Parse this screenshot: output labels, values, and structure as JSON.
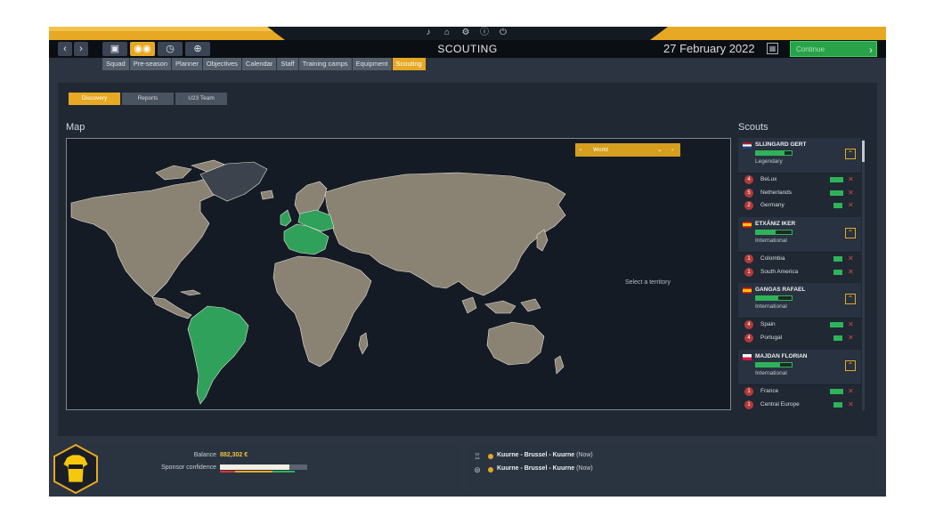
{
  "topbar": {
    "icons": [
      "bell-icon",
      "home-icon",
      "gear-icon",
      "info-icon",
      "power-icon"
    ],
    "colors": {
      "gold": "#e7a823",
      "bar": "#141a22"
    }
  },
  "navbar": {
    "back": "‹",
    "forward": "›",
    "title": "SCOUTING",
    "date": "27 February 2022",
    "continue_label": "Continue",
    "continue_arrow": "›"
  },
  "subtabs": [
    "Squad",
    "Pre-season",
    "Planner",
    "Objectives",
    "Calendar",
    "Staff",
    "Training camps",
    "Equipment",
    "Scouting"
  ],
  "active_subtab": "Scouting",
  "view_tabs": [
    "Discovery",
    "Reports",
    "U23 Team"
  ],
  "map": {
    "title": "Map",
    "region": "World",
    "hint": "Select a territory"
  },
  "scouts": {
    "title": "Scouts",
    "items": [
      {
        "name": "SLIJNGARD GERT",
        "rank": "Legendary",
        "flag": "netherlands",
        "skill": 0.8,
        "assignments": [
          {
            "count": "4",
            "region": "BeLux",
            "level": 3
          },
          {
            "count": "5",
            "region": "Netherlands",
            "level": 3
          },
          {
            "count": "2",
            "region": "Germany",
            "level": 2
          }
        ]
      },
      {
        "name": "ETXÁNIZ IKER",
        "rank": "International",
        "flag": "spain",
        "skill": 0.55,
        "assignments": [
          {
            "count": "1",
            "region": "Colombia",
            "level": 2
          },
          {
            "count": "1",
            "region": "South America",
            "level": 2
          }
        ]
      },
      {
        "name": "GANGAS RAFAEL",
        "rank": "International",
        "flag": "spain",
        "skill": 0.62,
        "assignments": [
          {
            "count": "4",
            "region": "Spain",
            "level": 3
          },
          {
            "count": "4",
            "region": "Portugal",
            "level": 2
          }
        ]
      },
      {
        "name": "MAJDAN FLORIAN",
        "rank": "International",
        "flag": "poland",
        "skill": 0.68,
        "assignments": [
          {
            "count": "1",
            "region": "France",
            "level": 3
          },
          {
            "count": "1",
            "region": "Central Europe",
            "level": 2
          }
        ]
      }
    ]
  },
  "finance": {
    "balance_label": "Balance",
    "balance_value": "882,302 €",
    "sponsor_label": "Sponsor confidence",
    "sponsor_confidence": 0.8
  },
  "races": [
    {
      "icon": "trophy-icon",
      "name": "Kuurne - Brussel - Kuurne",
      "status": "(Now)"
    },
    {
      "icon": "race-icon",
      "name": "Kuurne - Brussel - Kuurne",
      "status": "(Now)"
    }
  ]
}
